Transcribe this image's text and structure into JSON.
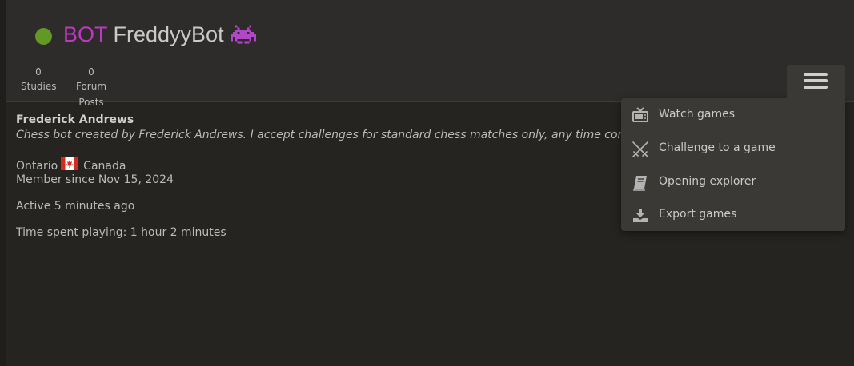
{
  "profile": {
    "bot_tag": "BOT",
    "username": "FreddyyBot",
    "status_color": "#629924",
    "bot_color": "#bf37c5",
    "title_icon": "alien-monster-icon"
  },
  "stats": [
    {
      "count": "0",
      "label": "Studies"
    },
    {
      "count": "0",
      "label": "Forum Posts"
    }
  ],
  "menu": {
    "toggle_icon": "hamburger-icon",
    "items": [
      {
        "label": "Watch games",
        "icon": "tv-icon"
      },
      {
        "label": "Challenge to a game",
        "icon": "crossed-swords-icon"
      },
      {
        "label": "Opening explorer",
        "icon": "book-icon"
      },
      {
        "label": "Export games",
        "icon": "download-icon"
      }
    ]
  },
  "bio": {
    "real_name": "Frederick Andrews",
    "description": "Chess bot created by Frederick Andrews. I accept challenges for standard chess matches only, any time control is al",
    "region": "Ontario",
    "country": "Canada",
    "country_flag_icon": "canada-flag-icon",
    "member_since": "Member since Nov 15, 2024",
    "active": "Active 5 minutes ago",
    "time_spent": "Time spent playing: 1 hour 2 minutes"
  }
}
